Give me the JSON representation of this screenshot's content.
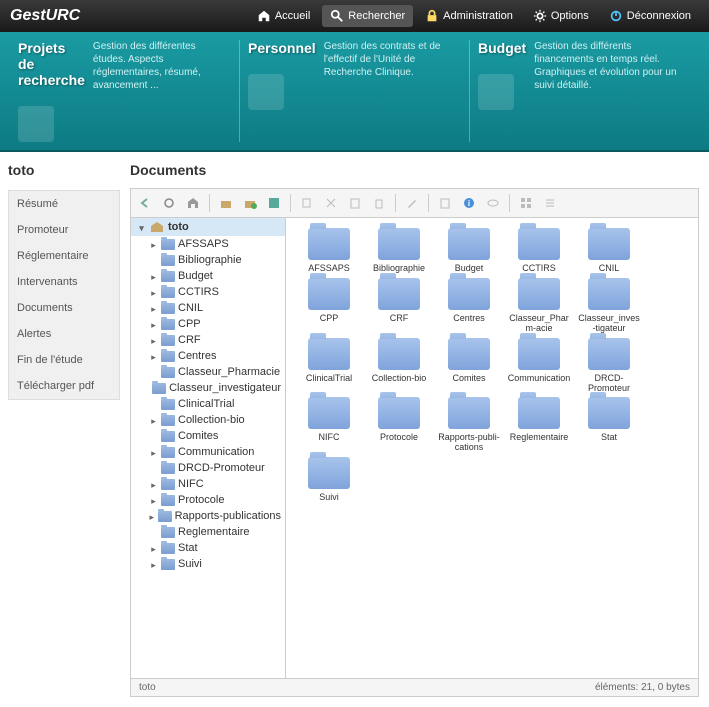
{
  "app": {
    "name": "GestURC"
  },
  "topnav": [
    {
      "label": "Accueil",
      "icon": "home"
    },
    {
      "label": "Rechercher",
      "icon": "search"
    },
    {
      "label": "Administration",
      "icon": "lock"
    },
    {
      "label": "Options",
      "icon": "gear"
    },
    {
      "label": "Déconnexion",
      "icon": "power"
    }
  ],
  "banner": [
    {
      "title": "Projets de recherche",
      "desc": "Gestion des différentes études. Aspects réglementaires, résumé, avancement ..."
    },
    {
      "title": "Personnel",
      "desc": "Gestion des contrats et de l'effectif de l'Unité de Recherche Clinique."
    },
    {
      "title": "Budget",
      "desc": "Gestion des différents financements en temps réel. Graphiques et évolution pour un suivi détaillé."
    }
  ],
  "project": "toto",
  "sidemenu": [
    "Résumé",
    "Promoteur",
    "Réglementaire",
    "Intervenants",
    "Documents",
    "Alertes",
    "Fin de l'étude",
    "Télécharger pdf"
  ],
  "content_title": "Documents",
  "tree_root": "toto",
  "tree": [
    {
      "label": "AFSSAPS",
      "exp": true
    },
    {
      "label": "Bibliographie",
      "exp": false
    },
    {
      "label": "Budget",
      "exp": true
    },
    {
      "label": "CCTIRS",
      "exp": true
    },
    {
      "label": "CNIL",
      "exp": true
    },
    {
      "label": "CPP",
      "exp": true
    },
    {
      "label": "CRF",
      "exp": true
    },
    {
      "label": "Centres",
      "exp": true
    },
    {
      "label": "Classeur_Pharmacie",
      "exp": false
    },
    {
      "label": "Classeur_investigateur",
      "exp": false
    },
    {
      "label": "ClinicalTrial",
      "exp": false
    },
    {
      "label": "Collection-bio",
      "exp": true
    },
    {
      "label": "Comites",
      "exp": false
    },
    {
      "label": "Communication",
      "exp": true
    },
    {
      "label": "DRCD-Promoteur",
      "exp": false
    },
    {
      "label": "NIFC",
      "exp": true
    },
    {
      "label": "Protocole",
      "exp": true
    },
    {
      "label": "Rapports-publications",
      "exp": true
    },
    {
      "label": "Reglementaire",
      "exp": false
    },
    {
      "label": "Stat",
      "exp": true
    },
    {
      "label": "Suivi",
      "exp": true
    }
  ],
  "folders": [
    "AFSSAPS",
    "Bibliographie",
    "Budget",
    "CCTIRS",
    "CNIL",
    "CPP",
    "CRF",
    "Centres",
    "Classeur_Pharm-acie",
    "Classeur_inves-tigateur",
    "ClinicalTrial",
    "Collection-bio",
    "Comites",
    "Communication",
    "DRCD-Promoteur",
    "NIFC",
    "Protocole",
    "Rapports-publi-cations",
    "Reglementaire",
    "Stat",
    "Suivi"
  ],
  "status": {
    "path": "toto",
    "info": "éléments: 21, 0 bytes"
  },
  "icons": {
    "home": "#fff",
    "search": "#fff",
    "lock": "#ffd966",
    "gear": "#fff",
    "power": "#4fc3f7"
  }
}
